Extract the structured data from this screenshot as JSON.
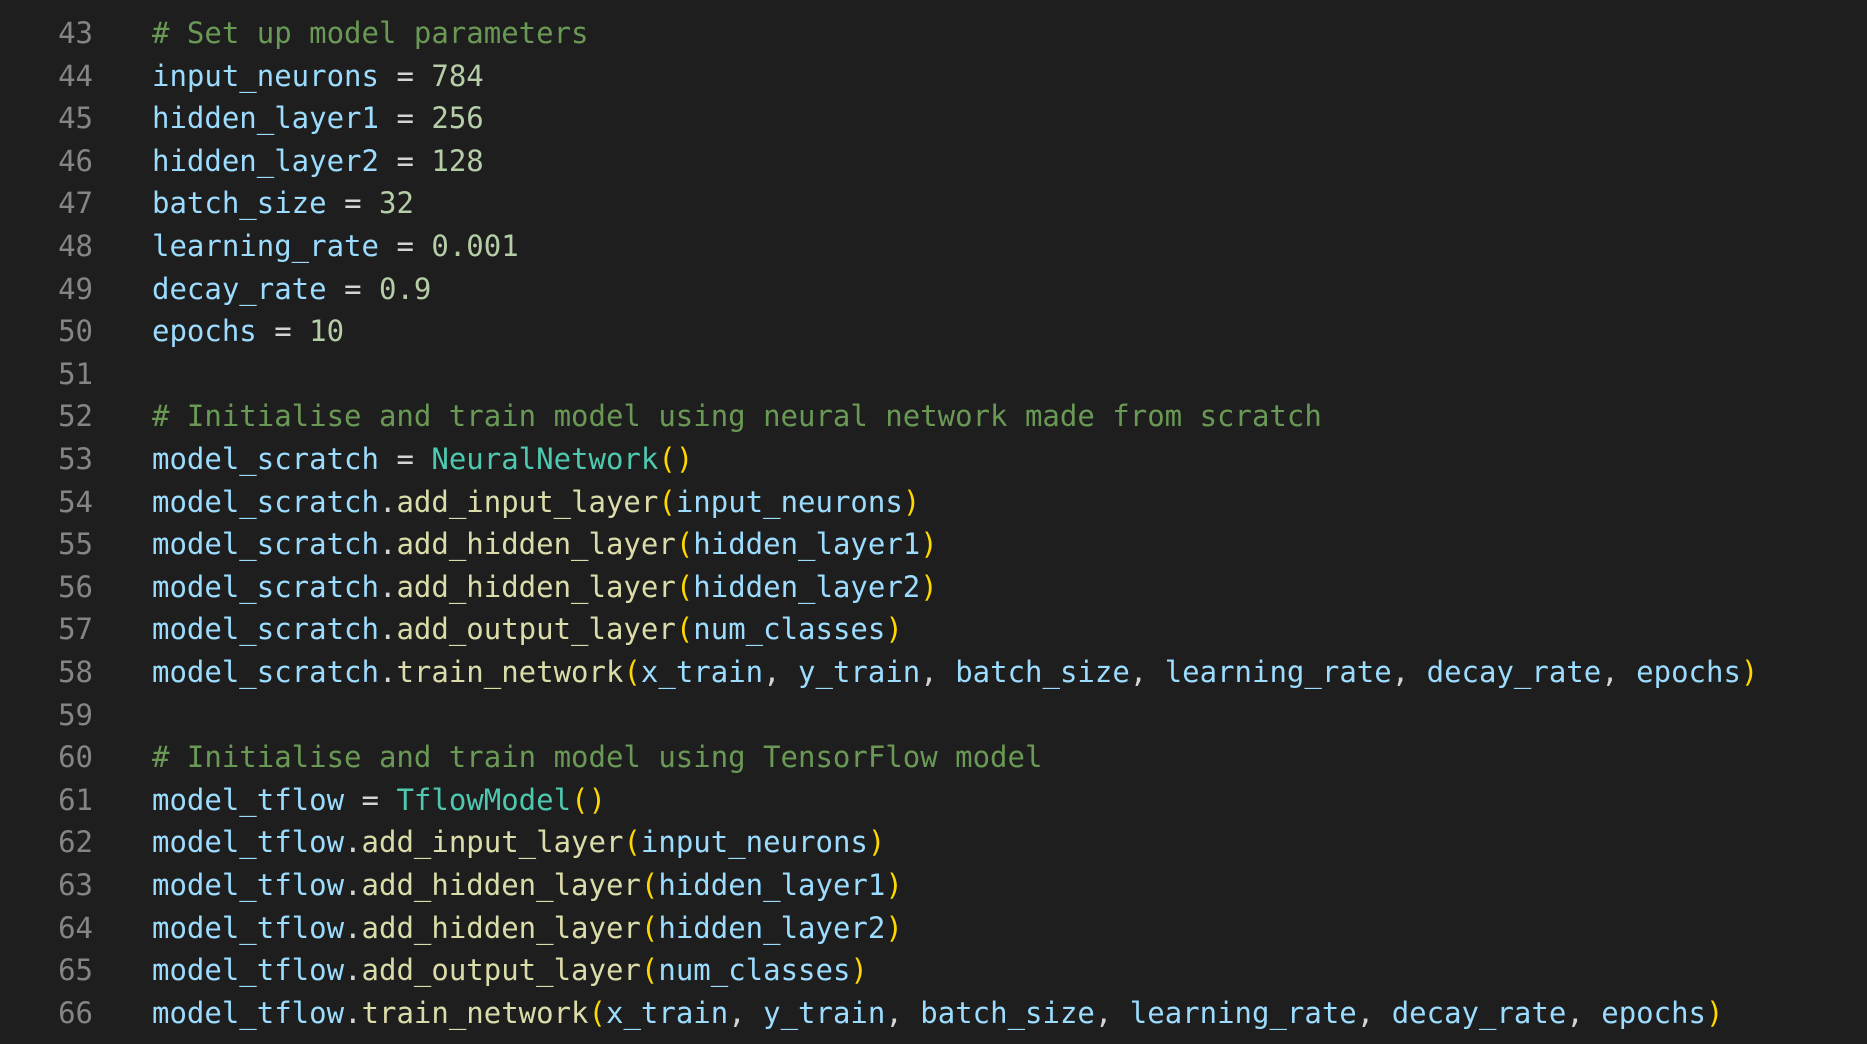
{
  "colors": {
    "background": "#1e1e1e",
    "line_number": "#858585",
    "comment": "#6a9955",
    "variable": "#9cdcfe",
    "operator": "#d4d4d4",
    "number": "#b5cea8",
    "class": "#4ec9b0",
    "function": "#dcdcaa",
    "bracket": "#ffd700"
  },
  "lines": [
    {
      "number": "43",
      "tokens": [
        {
          "t": "comment",
          "v": "# Set up model parameters"
        }
      ]
    },
    {
      "number": "44",
      "tokens": [
        {
          "t": "var",
          "v": "input_neurons"
        },
        {
          "t": "op",
          "v": " = "
        },
        {
          "t": "num",
          "v": "784"
        }
      ]
    },
    {
      "number": "45",
      "tokens": [
        {
          "t": "var",
          "v": "hidden_layer1"
        },
        {
          "t": "op",
          "v": " = "
        },
        {
          "t": "num",
          "v": "256"
        }
      ]
    },
    {
      "number": "46",
      "tokens": [
        {
          "t": "var",
          "v": "hidden_layer2"
        },
        {
          "t": "op",
          "v": " = "
        },
        {
          "t": "num",
          "v": "128"
        }
      ]
    },
    {
      "number": "47",
      "tokens": [
        {
          "t": "var",
          "v": "batch_size"
        },
        {
          "t": "op",
          "v": " = "
        },
        {
          "t": "num",
          "v": "32"
        }
      ]
    },
    {
      "number": "48",
      "tokens": [
        {
          "t": "var",
          "v": "learning_rate"
        },
        {
          "t": "op",
          "v": " = "
        },
        {
          "t": "num",
          "v": "0.001"
        }
      ]
    },
    {
      "number": "49",
      "tokens": [
        {
          "t": "var",
          "v": "decay_rate"
        },
        {
          "t": "op",
          "v": " = "
        },
        {
          "t": "num",
          "v": "0.9"
        }
      ]
    },
    {
      "number": "50",
      "tokens": [
        {
          "t": "var",
          "v": "epochs"
        },
        {
          "t": "op",
          "v": " = "
        },
        {
          "t": "num",
          "v": "10"
        }
      ]
    },
    {
      "number": "51",
      "tokens": []
    },
    {
      "number": "52",
      "tokens": [
        {
          "t": "comment",
          "v": "# Initialise and train model using neural network made from scratch"
        }
      ]
    },
    {
      "number": "53",
      "tokens": [
        {
          "t": "var",
          "v": "model_scratch"
        },
        {
          "t": "op",
          "v": " = "
        },
        {
          "t": "class",
          "v": "NeuralNetwork"
        },
        {
          "t": "paren",
          "v": "()"
        }
      ]
    },
    {
      "number": "54",
      "tokens": [
        {
          "t": "var",
          "v": "model_scratch"
        },
        {
          "t": "op",
          "v": "."
        },
        {
          "t": "func",
          "v": "add_input_layer"
        },
        {
          "t": "paren",
          "v": "("
        },
        {
          "t": "var",
          "v": "input_neurons"
        },
        {
          "t": "paren",
          "v": ")"
        }
      ]
    },
    {
      "number": "55",
      "tokens": [
        {
          "t": "var",
          "v": "model_scratch"
        },
        {
          "t": "op",
          "v": "."
        },
        {
          "t": "func",
          "v": "add_hidden_layer"
        },
        {
          "t": "paren",
          "v": "("
        },
        {
          "t": "var",
          "v": "hidden_layer1"
        },
        {
          "t": "paren",
          "v": ")"
        }
      ]
    },
    {
      "number": "56",
      "tokens": [
        {
          "t": "var",
          "v": "model_scratch"
        },
        {
          "t": "op",
          "v": "."
        },
        {
          "t": "func",
          "v": "add_hidden_layer"
        },
        {
          "t": "paren",
          "v": "("
        },
        {
          "t": "var",
          "v": "hidden_layer2"
        },
        {
          "t": "paren",
          "v": ")"
        }
      ]
    },
    {
      "number": "57",
      "tokens": [
        {
          "t": "var",
          "v": "model_scratch"
        },
        {
          "t": "op",
          "v": "."
        },
        {
          "t": "func",
          "v": "add_output_layer"
        },
        {
          "t": "paren",
          "v": "("
        },
        {
          "t": "var",
          "v": "num_classes"
        },
        {
          "t": "paren",
          "v": ")"
        }
      ]
    },
    {
      "number": "58",
      "tokens": [
        {
          "t": "var",
          "v": "model_scratch"
        },
        {
          "t": "op",
          "v": "."
        },
        {
          "t": "func",
          "v": "train_network"
        },
        {
          "t": "paren",
          "v": "("
        },
        {
          "t": "var",
          "v": "x_train"
        },
        {
          "t": "op",
          "v": ", "
        },
        {
          "t": "var",
          "v": "y_train"
        },
        {
          "t": "op",
          "v": ", "
        },
        {
          "t": "var",
          "v": "batch_size"
        },
        {
          "t": "op",
          "v": ", "
        },
        {
          "t": "var",
          "v": "learning_rate"
        },
        {
          "t": "op",
          "v": ", "
        },
        {
          "t": "var",
          "v": "decay_rate"
        },
        {
          "t": "op",
          "v": ", "
        },
        {
          "t": "var",
          "v": "epochs"
        },
        {
          "t": "paren",
          "v": ")"
        }
      ]
    },
    {
      "number": "59",
      "tokens": []
    },
    {
      "number": "60",
      "tokens": [
        {
          "t": "comment",
          "v": "# Initialise and train model using TensorFlow model"
        }
      ]
    },
    {
      "number": "61",
      "tokens": [
        {
          "t": "var",
          "v": "model_tflow"
        },
        {
          "t": "op",
          "v": " = "
        },
        {
          "t": "class",
          "v": "TflowModel"
        },
        {
          "t": "paren",
          "v": "()"
        }
      ]
    },
    {
      "number": "62",
      "tokens": [
        {
          "t": "var",
          "v": "model_tflow"
        },
        {
          "t": "op",
          "v": "."
        },
        {
          "t": "func",
          "v": "add_input_layer"
        },
        {
          "t": "paren",
          "v": "("
        },
        {
          "t": "var",
          "v": "input_neurons"
        },
        {
          "t": "paren",
          "v": ")"
        }
      ]
    },
    {
      "number": "63",
      "tokens": [
        {
          "t": "var",
          "v": "model_tflow"
        },
        {
          "t": "op",
          "v": "."
        },
        {
          "t": "func",
          "v": "add_hidden_layer"
        },
        {
          "t": "paren",
          "v": "("
        },
        {
          "t": "var",
          "v": "hidden_layer1"
        },
        {
          "t": "paren",
          "v": ")"
        }
      ]
    },
    {
      "number": "64",
      "tokens": [
        {
          "t": "var",
          "v": "model_tflow"
        },
        {
          "t": "op",
          "v": "."
        },
        {
          "t": "func",
          "v": "add_hidden_layer"
        },
        {
          "t": "paren",
          "v": "("
        },
        {
          "t": "var",
          "v": "hidden_layer2"
        },
        {
          "t": "paren",
          "v": ")"
        }
      ]
    },
    {
      "number": "65",
      "tokens": [
        {
          "t": "var",
          "v": "model_tflow"
        },
        {
          "t": "op",
          "v": "."
        },
        {
          "t": "func",
          "v": "add_output_layer"
        },
        {
          "t": "paren",
          "v": "("
        },
        {
          "t": "var",
          "v": "num_classes"
        },
        {
          "t": "paren",
          "v": ")"
        }
      ]
    },
    {
      "number": "66",
      "tokens": [
        {
          "t": "var",
          "v": "model_tflow"
        },
        {
          "t": "op",
          "v": "."
        },
        {
          "t": "func",
          "v": "train_network"
        },
        {
          "t": "paren",
          "v": "("
        },
        {
          "t": "var",
          "v": "x_train"
        },
        {
          "t": "op",
          "v": ", "
        },
        {
          "t": "var",
          "v": "y_train"
        },
        {
          "t": "op",
          "v": ", "
        },
        {
          "t": "var",
          "v": "batch_size"
        },
        {
          "t": "op",
          "v": ", "
        },
        {
          "t": "var",
          "v": "learning_rate"
        },
        {
          "t": "op",
          "v": ", "
        },
        {
          "t": "var",
          "v": "decay_rate"
        },
        {
          "t": "op",
          "v": ", "
        },
        {
          "t": "var",
          "v": "epochs"
        },
        {
          "t": "paren",
          "v": ")"
        }
      ]
    }
  ]
}
